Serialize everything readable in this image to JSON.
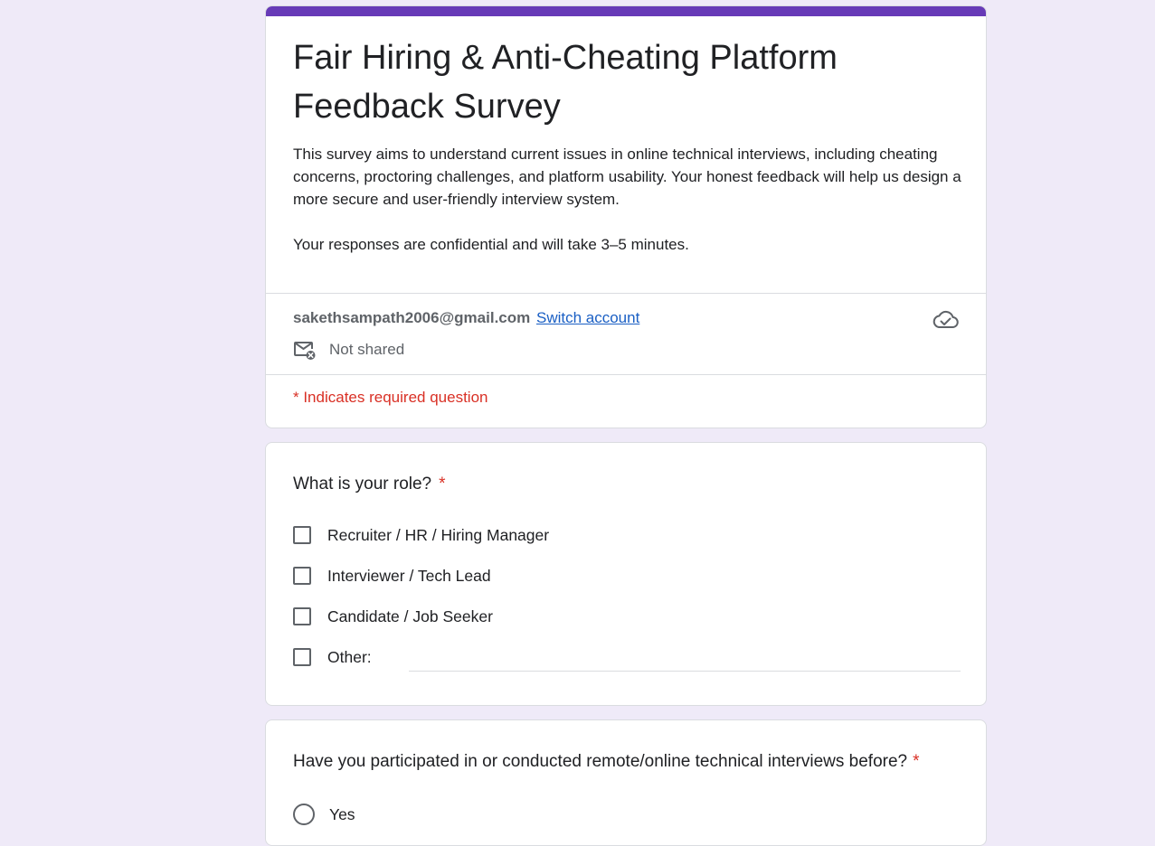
{
  "colors": {
    "background": "#efeaf8",
    "accent": "#673ab7",
    "required": "#d93025",
    "link": "#1a5fc4"
  },
  "header": {
    "title": "Fair Hiring & Anti-Cheating Platform Feedback Survey",
    "description": "This survey aims to understand current issues in online technical interviews, including cheating concerns, proctoring challenges, and platform usability. Your honest feedback will help us design a more secure and user-friendly interview system.\n\nYour responses are confidential and will take 3–5 minutes.",
    "account_email": "sakethsampath2006@gmail.com",
    "switch_account_label": "Switch account",
    "shared_status": "Not shared",
    "required_note": "* Indicates required question",
    "icons": {
      "saved": "cloud-check-icon",
      "shared": "mail-off-icon"
    }
  },
  "questions": [
    {
      "title": "What is your role?",
      "required_mark": "*",
      "type": "checkbox",
      "options": [
        "Recruiter / HR / Hiring Manager",
        "Interviewer / Tech Lead",
        "Candidate / Job Seeker",
        "Other:"
      ],
      "other_value": ""
    },
    {
      "title": "Have you participated in or conducted remote/online technical interviews before?",
      "required_mark": "*",
      "type": "radio",
      "options": [
        "Yes"
      ]
    }
  ]
}
